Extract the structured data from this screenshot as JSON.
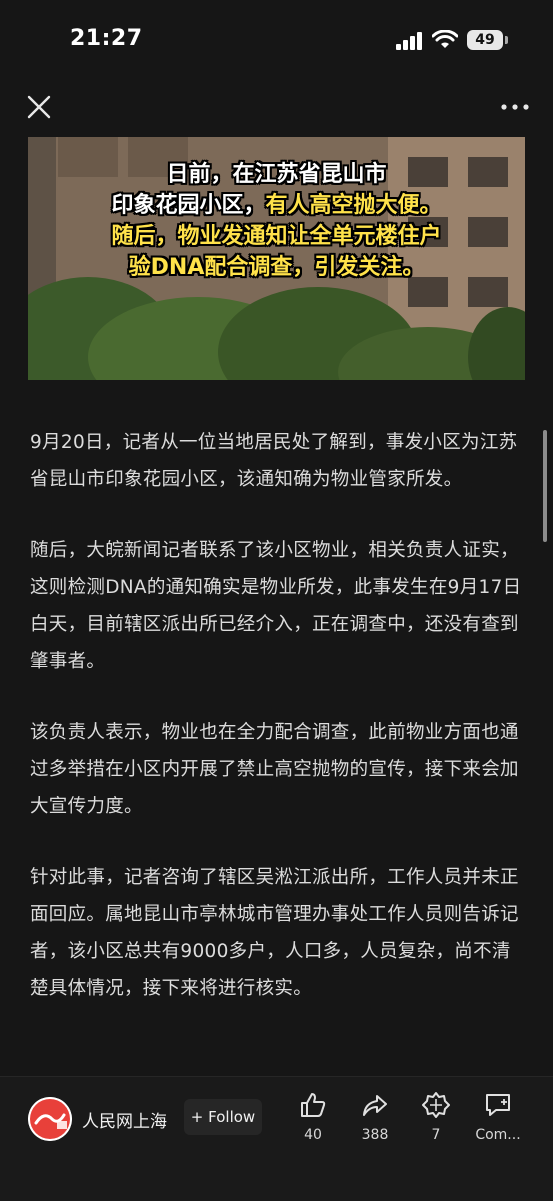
{
  "status_bar": {
    "time": "21:27",
    "battery": "49",
    "icons": [
      "signal-icon",
      "wifi-icon",
      "battery-icon"
    ]
  },
  "nav": {
    "close_icon": "close-icon",
    "more_icon": "more-icon"
  },
  "hero": {
    "caption_lines": [
      [
        {
          "text": "日前，在江苏省昆山市",
          "color": "white"
        }
      ],
      [
        {
          "text": "印象花园小区，",
          "color": "white"
        },
        {
          "text": "有人高空抛大便。",
          "color": "yellow"
        }
      ],
      [
        {
          "text": "随后，物业发通知让全单元楼住户",
          "color": "yellow"
        }
      ],
      [
        {
          "text": "验DNA配合调查，引发关注。",
          "color": "yellow"
        }
      ]
    ],
    "caption_colors": {
      "white": "#ffffff",
      "yellow": "#ffe24a"
    }
  },
  "article": {
    "paragraphs": [
      "9月20日，记者从一位当地居民处了解到，事发小区为江苏省昆山市印象花园小区，该通知确为物业管家所发。",
      "随后，大皖新闻记者联系了该小区物业，相关负责人证实，这则检测DNA的通知确实是物业所发，此事发生在9月17日白天，目前辖区派出所已经介入，正在调查中，还没有查到肇事者。",
      "该负责人表示，物业也在全力配合调查，此前物业方面也通过多举措在小区内开展了禁止高空抛物的宣传，接下来会加大宣传力度。",
      "针对此事，记者咨询了辖区吴淞江派出所，工作人员并未正面回应。属地昆山市亭林城市管理办事处工作人员则告诉记者，该小区总共有9000多户，人口多，人员复杂，尚不清楚具体情况，接下来将进行核实。"
    ]
  },
  "bottom_bar": {
    "source_name": "人民网上海",
    "avatar_text": "人民网",
    "follow_label": "+ Follow",
    "actions": [
      {
        "name": "like",
        "icon": "thumbs-up-icon",
        "count": "40"
      },
      {
        "name": "share",
        "icon": "share-icon",
        "count": "388"
      },
      {
        "name": "reward",
        "icon": "badge-icon",
        "count": "7"
      },
      {
        "name": "comment",
        "icon": "comment-icon",
        "count": "Com..."
      }
    ]
  },
  "colors": {
    "background": "#161616",
    "text": "#dcdcdc",
    "caption_yellow": "#ffe24a"
  }
}
